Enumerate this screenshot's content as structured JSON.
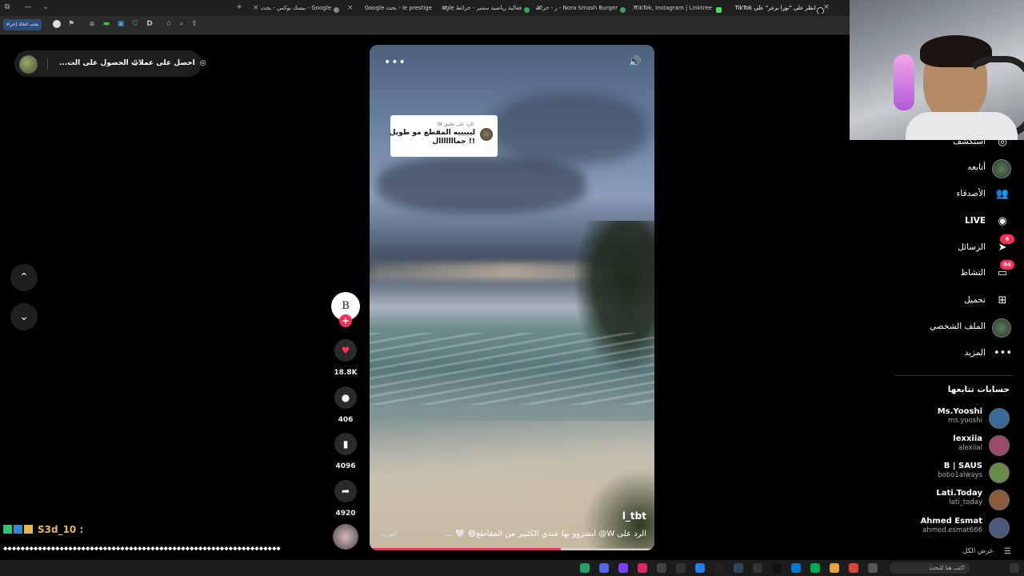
{
  "browser": {
    "tabs": [
      {
        "label": "Google - بيسك بوكس - بحث"
      },
      {
        "label": "le prestige - بحث Google"
      },
      {
        "label": "فعالية رياضية سمير - خرائط Google"
      },
      {
        "label": "Nora Smash Burger - ر - خرائط"
      },
      {
        "label": "TikTok, Instagram | Linktree"
      },
      {
        "label": "انظر على \"نورا برغر\" على TikTok"
      }
    ],
    "toolbar_button": "يجب اتخاذ إجراء"
  },
  "top_pill": {
    "get_coins": "احصل على عملات",
    "get_app": "الحصول على الت..."
  },
  "nav": {
    "up": "⌃",
    "down": "⌄"
  },
  "video": {
    "more_icon": "•••",
    "volume_icon": "🔊",
    "reply_card": {
      "header": "الرد على تعليق W",
      "text": "ليييييه المقطع مو طويل !! جمااااااال"
    },
    "author": "l_tbt",
    "caption": "الرد على W@ ابشروو بها عندي الكثيير من المقاطع😄 🤍 ...",
    "more_link": "المزيد",
    "progress": 0.67
  },
  "actions": {
    "creator_initials": "B",
    "likes": "18.8K",
    "comments": "406",
    "saves": "4096",
    "shares": "4920"
  },
  "sidebar": {
    "items": [
      {
        "label": "استكشف",
        "icon": "compass-icon",
        "glyph": "◎"
      },
      {
        "label": "أتابعه",
        "icon": "avatar",
        "glyph": ""
      },
      {
        "label": "الأصدقاء",
        "icon": "friends-icon",
        "glyph": "👥"
      },
      {
        "label": "LIVE",
        "icon": "live-icon",
        "glyph": "◉"
      },
      {
        "label": "الرسائل",
        "icon": "messages-icon",
        "glyph": "➤",
        "badge": "6"
      },
      {
        "label": "النشاط",
        "icon": "activity-icon",
        "glyph": "▭",
        "badge": "84"
      },
      {
        "label": "تحميل",
        "icon": "upload-icon",
        "glyph": "⊞"
      },
      {
        "label": "الملف الشخصي",
        "icon": "profile-avatar",
        "glyph": ""
      },
      {
        "label": "المزيد",
        "icon": "more-icon",
        "glyph": "•••"
      }
    ],
    "following_heading": "حسابات تتابعها",
    "accounts": [
      {
        "name": "Ms.Yooshi",
        "handle": "ms.yooshi",
        "color": "#3a6a9a"
      },
      {
        "name": "lexxiia",
        "handle": "alexiial",
        "color": "#9a4a6a"
      },
      {
        "name": "B | SAUS",
        "handle": "bobo1always",
        "color": "#6a8a4a"
      },
      {
        "name": "Lati.Today",
        "handle": "lati_today",
        "color": "#8a5a3a"
      },
      {
        "name": "Ahmed Esmat",
        "handle": "ahmed.esmat666",
        "color": "#4a5a7a"
      }
    ],
    "see_all": "عرض الكل"
  },
  "chat": {
    "user": "S3d_10 :",
    "line1": "◆◆◆◆◆◆◆◆◆◆◆◆◆◆◆◆◆◆◆◆◆◆◆◆◆◆◆◆◆◆◆◆◆◆◆◆◆◆◆◆◆◆◆◆◆◆◆◆◆◆◆◆◆◆◆◆◆◆◆◆◆◆◆◆",
    "line2": "◆◆◆◆◆◆◆◆◆◆◆◆◆◆◆◆◆◆◆◆◆◆◆◆◆◆◆◆◆◆◆◆◆◆◆◆◆◆◆◆"
  },
  "taskbar": {
    "search_placeholder": "اكتب هنا للبحث"
  },
  "colors": {
    "accent": "#fe2c55",
    "chat_user": "#e8b84a"
  }
}
